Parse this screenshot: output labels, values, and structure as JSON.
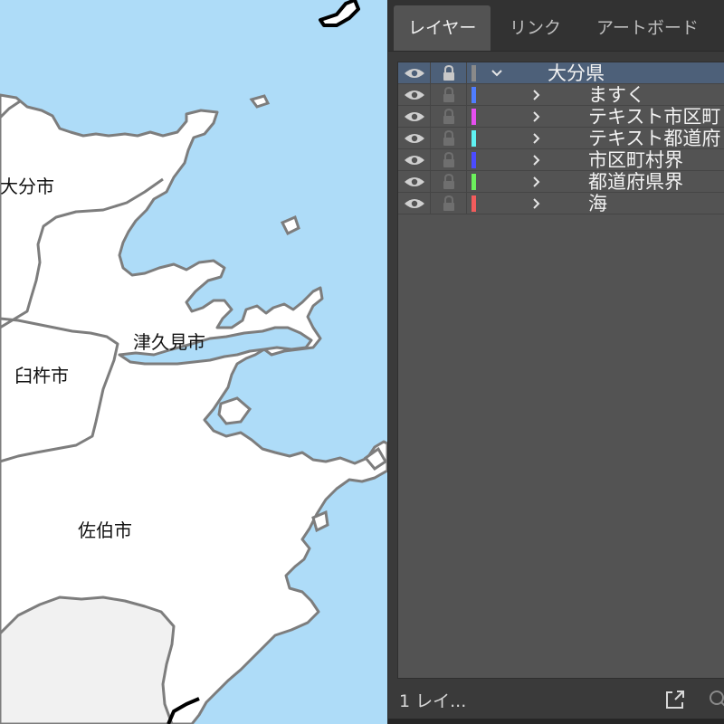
{
  "map": {
    "colors": {
      "sea": "#aedcf8",
      "land": "#ffffff",
      "neighbor_land": "#f1f1f1",
      "border": "#7d7d7d",
      "prefecture_border": "#000000"
    },
    "city_labels": [
      {
        "name": "大分市"
      },
      {
        "name": "津久見市"
      },
      {
        "name": "臼杵市"
      },
      {
        "name": "佐伯市"
      }
    ]
  },
  "panel": {
    "tabs": [
      {
        "label": "レイヤー",
        "active": true
      },
      {
        "label": "リンク",
        "active": false
      },
      {
        "label": "アートボード",
        "active": false
      }
    ],
    "layers": [
      {
        "name": "大分県",
        "color": "#8a8a8a",
        "expanded": true,
        "level": 0,
        "icon": "chevron-down-icon"
      },
      {
        "name": "ますく",
        "color": "#4f7dff",
        "expanded": false,
        "level": 1,
        "icon": "chevron-right-icon"
      },
      {
        "name": "テキスト市区町",
        "color": "#e64ff0",
        "expanded": false,
        "level": 1,
        "icon": "chevron-right-icon"
      },
      {
        "name": "テキスト都道府",
        "color": "#5ff2f2",
        "expanded": false,
        "level": 1,
        "icon": "chevron-right-icon"
      },
      {
        "name": "市区町村界",
        "color": "#4b4bff",
        "expanded": false,
        "level": 1,
        "icon": "chevron-right-icon"
      },
      {
        "name": "都道府県界",
        "color": "#6cf05c",
        "expanded": false,
        "level": 1,
        "icon": "chevron-right-icon"
      },
      {
        "name": "海",
        "color": "#f25c5c",
        "expanded": false,
        "level": 1,
        "icon": "chevron-right-icon"
      }
    ],
    "footer": {
      "layer_count": "1 レイ...",
      "export_icon": "export-icon",
      "search_icon": "search-icon"
    }
  }
}
